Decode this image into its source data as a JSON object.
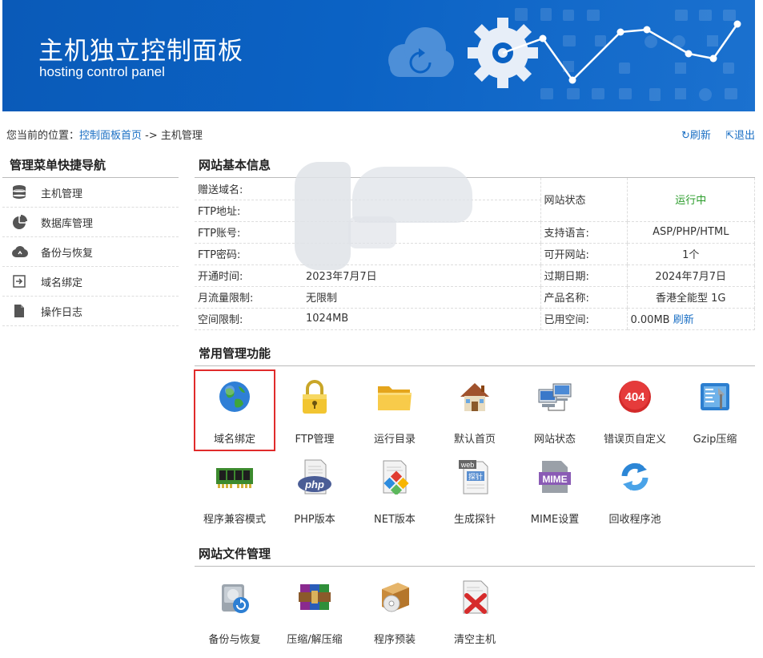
{
  "banner": {
    "title": "主机独立控制面板",
    "subtitle": "hosting control panel"
  },
  "breadcrumb": {
    "prefix": "您当前的位置：",
    "home_link": "控制面板首页",
    "separator": " -> ",
    "current": "主机管理"
  },
  "top_actions": {
    "refresh_label": "刷新",
    "logout_label": "退出"
  },
  "sidebar": {
    "title": "管理菜单快捷导航",
    "items": [
      {
        "label": "主机管理",
        "icon": "database-icon"
      },
      {
        "label": "数据库管理",
        "icon": "pie-chart-icon"
      },
      {
        "label": "备份与恢复",
        "icon": "cloud-icon"
      },
      {
        "label": "域名绑定",
        "icon": "login-arrow-icon"
      },
      {
        "label": "操作日志",
        "icon": "document-icon"
      }
    ]
  },
  "site_info": {
    "title": "网站基本信息",
    "rows": [
      {
        "key": "赠送域名:",
        "value": ""
      },
      {
        "key": "FTP地址:",
        "value": ""
      },
      {
        "key": "FTP账号:",
        "value": ""
      },
      {
        "key": "FTP密码:",
        "value": ""
      },
      {
        "key": "开通时间:",
        "value": "2023年7月7日"
      },
      {
        "key": "月流量限制:",
        "value": "无限制"
      },
      {
        "key": "空间限制:",
        "value": "1024MB"
      }
    ],
    "right_rows": [
      {
        "key": "网站状态",
        "value": "运行中"
      },
      {
        "key": "支持语言:",
        "value": "ASP/PHP/HTML"
      },
      {
        "key": "可开网站:",
        "value": "1个"
      },
      {
        "key": "过期日期:",
        "value": "2024年7月7日"
      },
      {
        "key": "产品名称:",
        "value": "香港全能型 1G"
      },
      {
        "key": "已用空间:",
        "value": "0.00MB",
        "link": "刷新"
      }
    ],
    "status_color": "#2a9c2a"
  },
  "common_functions": {
    "title": "常用管理功能",
    "items": [
      {
        "label": "域名绑定",
        "icon": "globe-icon",
        "selected": true
      },
      {
        "label": "FTP管理",
        "icon": "padlock-icon"
      },
      {
        "label": "运行目录",
        "icon": "folder-icon"
      },
      {
        "label": "默认首页",
        "icon": "house-icon"
      },
      {
        "label": "网站状态",
        "icon": "network-computers-icon"
      },
      {
        "label": "错误页自定义",
        "icon": "error-404-icon",
        "badge": "404"
      },
      {
        "label": "Gzip压缩",
        "icon": "gzip-compress-icon"
      },
      {
        "label": "程序兼容模式",
        "icon": "memory-chip-icon"
      },
      {
        "label": "PHP版本",
        "icon": "php-file-icon",
        "badge": "php"
      },
      {
        "label": "NET版本",
        "icon": "net-file-icon"
      },
      {
        "label": "生成探针",
        "icon": "web-probe-icon",
        "badge": "web",
        "badge2": "探针"
      },
      {
        "label": "MIME设置",
        "icon": "mime-icon",
        "badge": "MIME"
      },
      {
        "label": "回收程序池",
        "icon": "recycle-icon"
      }
    ]
  },
  "file_management": {
    "title": "网站文件管理",
    "items": [
      {
        "label": "备份与恢复",
        "icon": "disk-backup-icon"
      },
      {
        "label": "压缩/解压缩",
        "icon": "winrar-books-icon"
      },
      {
        "label": "程序预装",
        "icon": "package-cd-icon"
      },
      {
        "label": "清空主机",
        "icon": "delete-file-icon"
      }
    ]
  },
  "colors": {
    "banner": "#0b62c4",
    "link": "#1a6fc4",
    "selected_outline": "#e02b2b"
  }
}
